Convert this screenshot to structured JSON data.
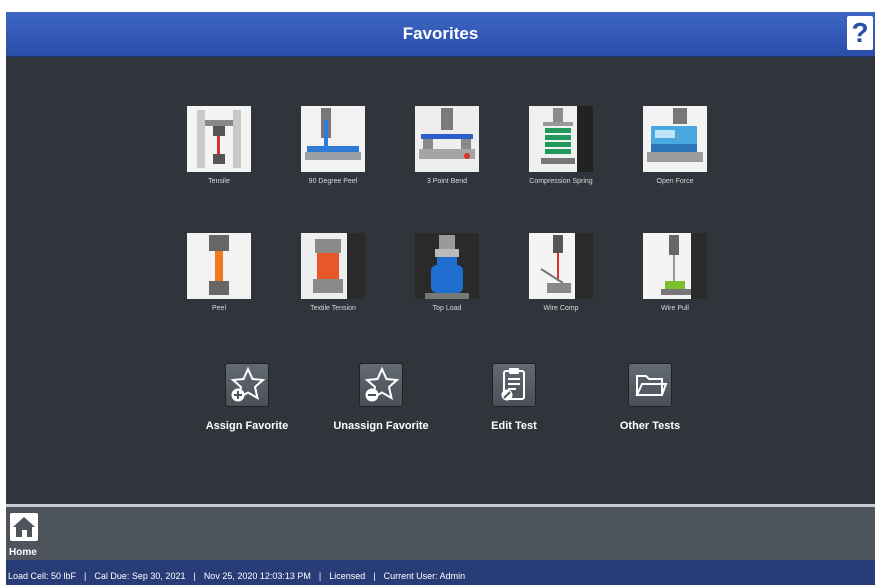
{
  "header": {
    "title": "Favorites",
    "help_label": "?"
  },
  "favorites": [
    {
      "label": "Tensile",
      "icon": "tensile-test-image"
    },
    {
      "label": "90 Degree Peel",
      "icon": "peel-90-degree-image"
    },
    {
      "label": "3 Point Bend",
      "icon": "three-point-bend-image"
    },
    {
      "label": "Compression Spring",
      "icon": "compression-spring-image"
    },
    {
      "label": "Open Force",
      "icon": "open-force-image"
    },
    {
      "label": "Peel",
      "icon": "peel-test-image"
    },
    {
      "label": "Textile Tension",
      "icon": "textile-tension-image"
    },
    {
      "label": "Top Load",
      "icon": "top-load-image"
    },
    {
      "label": "Wire Comp",
      "icon": "wire-comp-image"
    },
    {
      "label": "Wire Pull",
      "icon": "wire-pull-image"
    }
  ],
  "actions": [
    {
      "label": "Assign Favorite",
      "icon": "star-plus-icon"
    },
    {
      "label": "Unassign Favorite",
      "icon": "star-minus-icon"
    },
    {
      "label": "Edit Test",
      "icon": "clipboard-edit-icon"
    },
    {
      "label": "Other Tests",
      "icon": "folder-open-icon"
    }
  ],
  "footer": {
    "home_label": "Home"
  },
  "status": {
    "load_cell": "Load Cell: 50 lbF",
    "cal_due": "Cal Due: Sep 30, 2021",
    "datetime": "Nov 25, 2020 12:03:13 PM",
    "license": "Licensed",
    "user": "Current User: Admin"
  },
  "colors": {
    "header": "#2a4ea8",
    "background": "#2f353b",
    "footer": "#4d545c",
    "statusbar": "#283d78"
  }
}
